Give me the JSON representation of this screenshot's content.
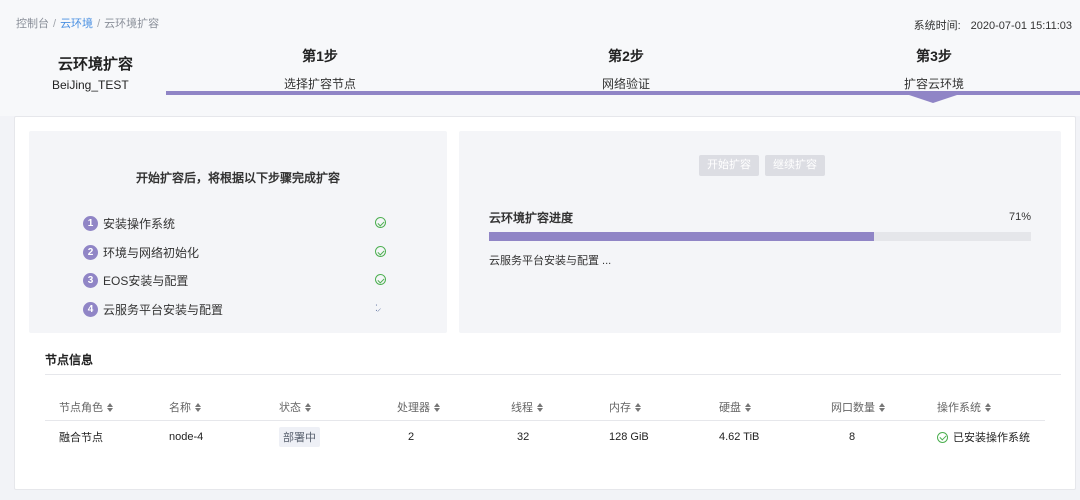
{
  "breadcrumb": {
    "items": [
      "控制台",
      "云环境",
      "云环境扩容"
    ],
    "separator": "/"
  },
  "system_time": {
    "label": "系统时间:",
    "value": "2020-07-01 15:11:03"
  },
  "environment": {
    "title": "云环境扩容",
    "name": "BeiJing_TEST"
  },
  "steps": [
    {
      "number": "第1步",
      "label": "选择扩容节点"
    },
    {
      "number": "第2步",
      "label": "网络验证"
    },
    {
      "number": "第3步",
      "label": "扩容云环境"
    }
  ],
  "active_step": 3,
  "colors": {
    "accent": "#9085c6",
    "success": "#4caf50",
    "link": "#4a90e2"
  },
  "instructions": {
    "title": "开始扩容后，将根据以下步骤完成扩容",
    "tasks": [
      {
        "index": "1",
        "label": "安装操作系统",
        "status": "done",
        "icon": "check-circle-icon"
      },
      {
        "index": "2",
        "label": "环境与网络初始化",
        "status": "done",
        "icon": "check-circle-icon"
      },
      {
        "index": "3",
        "label": "EOS安装与配置",
        "status": "done",
        "icon": "check-circle-icon"
      },
      {
        "index": "4",
        "label": "云服务平台安装与配置",
        "status": "in-progress",
        "icon": "loading-icon"
      }
    ]
  },
  "progress": {
    "start_button": "开始扩容",
    "continue_button": "继续扩容",
    "title": "云环境扩容进度",
    "percent_text": "71%",
    "percent": 71,
    "status_text": "云服务平台安装与配置 ..."
  },
  "node_info": {
    "title": "节点信息",
    "columns": [
      "节点角色",
      "名称",
      "状态",
      "处理器",
      "线程",
      "内存",
      "硬盘",
      "网口数量",
      "操作系统"
    ],
    "rows": [
      {
        "role": "融合节点",
        "name": "node-4",
        "status": "部署中",
        "cpu": "2",
        "threads": "32",
        "memory": "128 GiB",
        "disk": "4.62 TiB",
        "nic_count": "8",
        "os": "已安装操作系统"
      }
    ]
  }
}
